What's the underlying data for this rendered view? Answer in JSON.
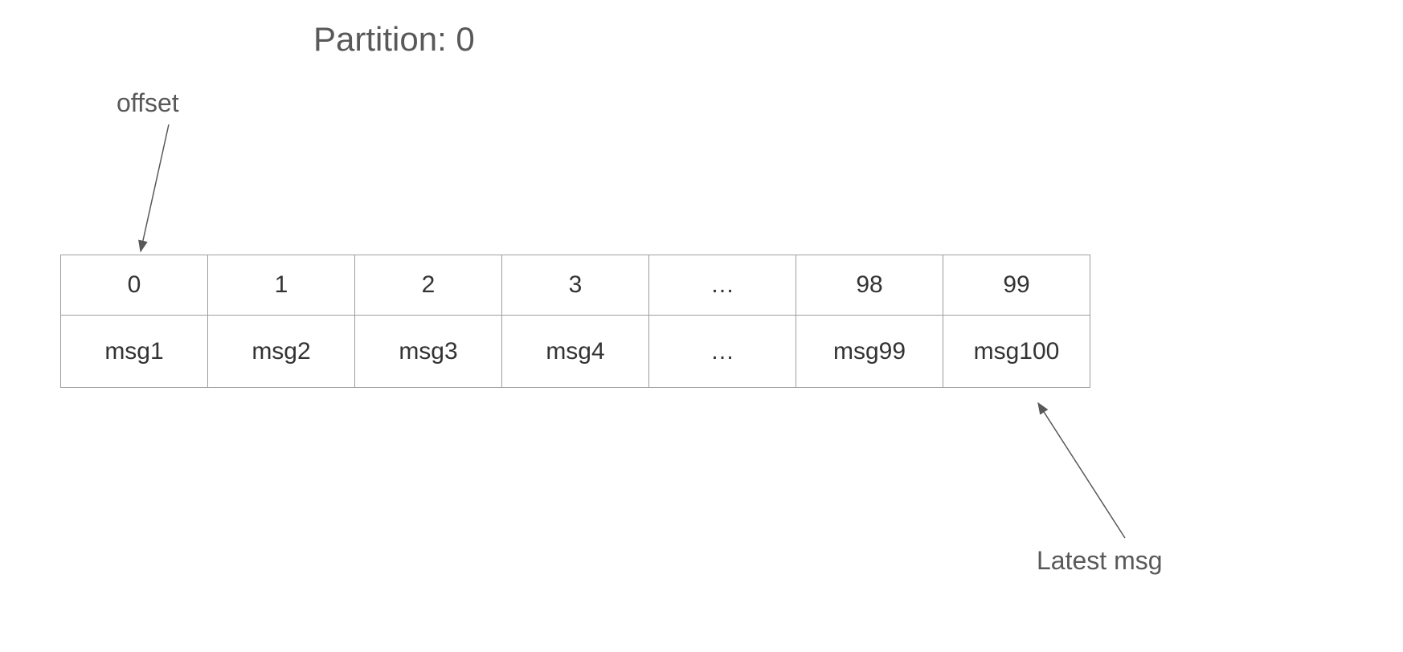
{
  "title": "Partition: 0",
  "labels": {
    "offset": "offset",
    "latest": "Latest msg"
  },
  "table": {
    "offsets": [
      "0",
      "1",
      "2",
      "3",
      "…",
      "98",
      "99"
    ],
    "messages": [
      "msg1",
      "msg2",
      "msg3",
      "msg4",
      "…",
      "msg99",
      "msg100"
    ]
  }
}
